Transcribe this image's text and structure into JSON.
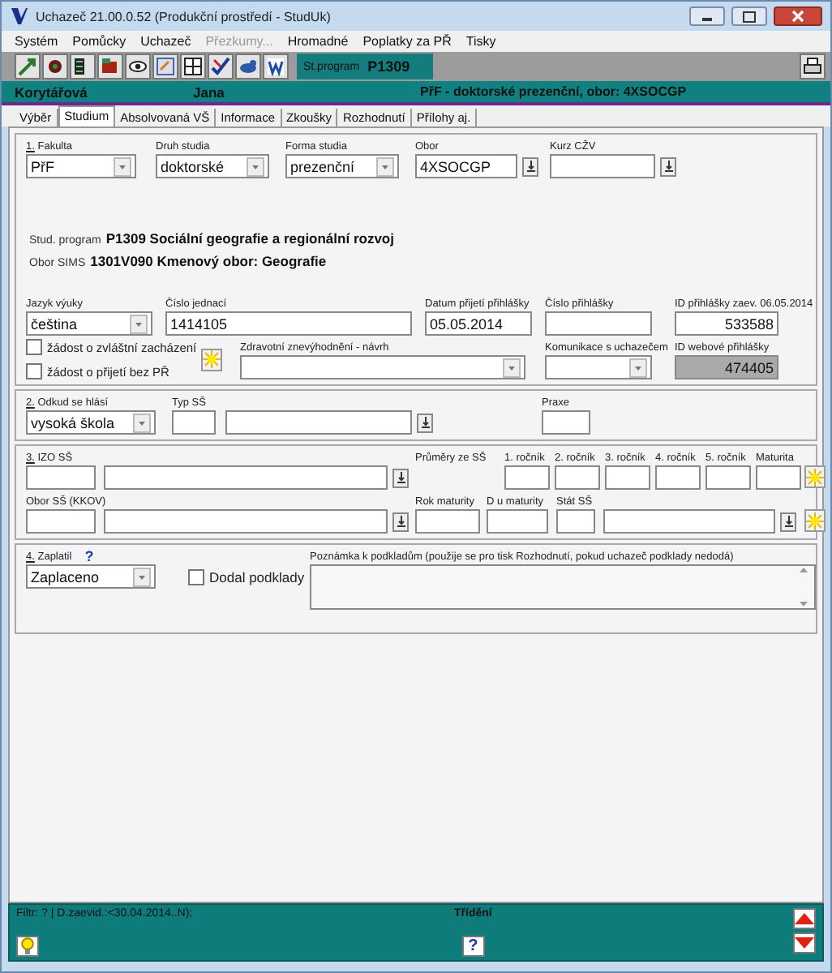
{
  "window": {
    "title": "Uchazeč  21.00.0.52  (Produkční prostředí - StudUk)"
  },
  "menu": [
    {
      "label": "Systém",
      "disabled": false
    },
    {
      "label": "Pomůcky",
      "disabled": false
    },
    {
      "label": "Uchazeč",
      "disabled": false
    },
    {
      "label": "Přezkumy...",
      "disabled": true
    },
    {
      "label": "Hromadné",
      "disabled": false
    },
    {
      "label": "Poplatky za PŘ",
      "disabled": false
    },
    {
      "label": "Tisky",
      "disabled": false
    }
  ],
  "toolbar": {
    "program_label": "St.program",
    "program_value": "P1309"
  },
  "header": {
    "surname": "Korytářová",
    "name": "Jana",
    "info": "PřF - doktorské prezenční, obor: 4XSOCGP"
  },
  "tabs": [
    {
      "label": "Výběr",
      "selected": false
    },
    {
      "label": "Studium",
      "selected": true
    },
    {
      "label": "Absolvovaná VŠ",
      "selected": false
    },
    {
      "label": "Informace",
      "selected": false
    },
    {
      "label": "Zkoušky",
      "selected": false
    },
    {
      "label": "Rozhodnutí",
      "selected": false
    },
    {
      "label": "Přílohy aj.",
      "selected": false
    }
  ],
  "sections": [
    {
      "rows": [
        {
          "fields": [
            {
              "kind": "select",
              "number": "1.",
              "label": "Fakulta",
              "value": "PřF"
            },
            {
              "kind": "select",
              "label": "Druh studia",
              "value": "doktorské"
            },
            {
              "kind": "select",
              "label": "Forma studia",
              "value": "prezenční"
            },
            {
              "kind": "lookup",
              "label": "Obor",
              "value": "4XSOCGP"
            },
            {
              "kind": "lookup",
              "label": "Kurz CŽV"
            }
          ]
        },
        {
          "fields": [
            {
              "kind": "select",
              "label": "Jazyk výuky",
              "value": "čeština"
            },
            {
              "kind": "text",
              "label": "Číslo jednací",
              "value": "1414105"
            },
            {
              "kind": "text",
              "label": "Datum přijetí přihlášky",
              "value": "05.05.2014"
            },
            {
              "kind": "text",
              "label": "Číslo přihlášky"
            },
            {
              "kind": "numeric",
              "label": "ID přihlášky zaev. 06.05.2014",
              "value": "533588",
              "disabled": false
            }
          ]
        },
        {
          "fields": [
            {
              "kind": "checkgroup",
              "items": [
                {
                  "label": "žádost o zvláštní zacházení",
                  "checked": false
                },
                {
                  "label": "žádost o přijetí bez PŘ",
                  "checked": false
                }
              ]
            },
            {
              "kind": "select",
              "label": "Zdravotní znevýhodnění - návrh"
            },
            {
              "kind": "select",
              "label": "Komunikace s uchazečem"
            },
            {
              "kind": "numeric",
              "label": "ID webové přihlášky",
              "value": "474405",
              "disabled": true
            }
          ]
        }
      ],
      "info": [
        {
          "label": "Stud. program",
          "value": "P1309 Sociální geografie a regionální rozvoj"
        },
        {
          "label": "Obor SIMS",
          "value": "1301V090 Kmenový obor: Geografie"
        }
      ]
    },
    {
      "rows": [
        {
          "fields": [
            {
              "kind": "select",
              "number": "2.",
              "label": "Odkud se hlásí",
              "value": "vysoká škola"
            },
            {
              "kind": "text",
              "label": "Typ SŠ"
            },
            {
              "kind": "lookup"
            },
            {
              "kind": "text",
              "label": "Praxe"
            }
          ]
        }
      ]
    },
    {
      "rows": [
        {
          "fields": [
            {
              "kind": "text",
              "number": "3.",
              "label": "IZO SŠ"
            },
            {
              "kind": "lookup"
            },
            {
              "kind": "caption",
              "label": "Průměry ze SŠ"
            },
            {
              "kind": "text",
              "label": "1. ročník"
            },
            {
              "kind": "text",
              "label": "2. ročník"
            },
            {
              "kind": "text",
              "label": "3. ročník"
            },
            {
              "kind": "text",
              "label": "4. ročník"
            },
            {
              "kind": "text",
              "label": "5. ročník"
            },
            {
              "kind": "text",
              "label": "Maturita"
            },
            {
              "kind": "sun"
            }
          ]
        },
        {
          "fields": [
            {
              "kind": "text",
              "label": "Obor SŠ (KKOV)"
            },
            {
              "kind": "lookup"
            },
            {
              "kind": "text",
              "label": "Rok maturity"
            },
            {
              "kind": "text",
              "label": "D u maturity"
            },
            {
              "kind": "text",
              "label": "Stát SŠ"
            },
            {
              "kind": "lookup"
            },
            {
              "kind": "sun"
            }
          ]
        }
      ]
    },
    {
      "rows": [
        {
          "fields": [
            {
              "kind": "select",
              "number": "4.",
              "label": "Zaplatil",
              "help": "?",
              "value": "Zaplaceno"
            },
            {
              "kind": "checkbox",
              "label": "Dodal podklady",
              "checked": false
            },
            {
              "kind": "textarea",
              "label": "Poznámka k podkladům  (použije se pro tisk Rozhodnutí, pokud uchazeč podklady nedodá)"
            }
          ]
        }
      ]
    }
  ],
  "status": {
    "filter": "Filtr: ?  | D.zaevid.:<30.04.2014..N);",
    "sort_label": "Třídění",
    "help_button": "?"
  }
}
